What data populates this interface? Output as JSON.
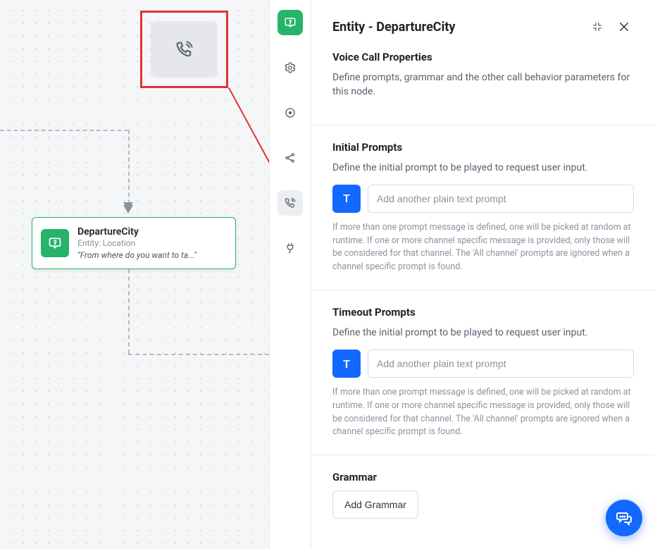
{
  "panel": {
    "title": "Entity - DepartureCity"
  },
  "sections": {
    "voice": {
      "heading": "Voice Call Properties",
      "lead": "Define prompts, grammar and the other call behavior parameters for this node."
    },
    "initial": {
      "heading": "Initial Prompts",
      "lead": "Define the initial prompt to be played to request user input.",
      "placeholder": "Add another plain text prompt",
      "help": "If more than one prompt message is defined, one will be picked at random at runtime. If one or more channel specific message is provided, only those will be considered for that channel. The 'All channel' prompts are ignored when a channel specific prompt is found."
    },
    "timeout": {
      "heading": "Timeout Prompts",
      "lead": "Define the initial prompt to be played to request user input.",
      "placeholder": "Add another plain text prompt",
      "help": "If more than one prompt message is defined, one will be picked at random at runtime. If one or more channel specific message is provided, only those will be considered for that channel. The 'All channel' prompts are ignored when a channel specific prompt is found."
    },
    "grammar": {
      "heading": "Grammar",
      "button": "Add Grammar"
    }
  },
  "node": {
    "title": "DepartureCity",
    "subtitle": "Entity: Location",
    "prompt": "\"From where do you want to ta...\""
  },
  "iconLabels": {
    "t": "T"
  }
}
